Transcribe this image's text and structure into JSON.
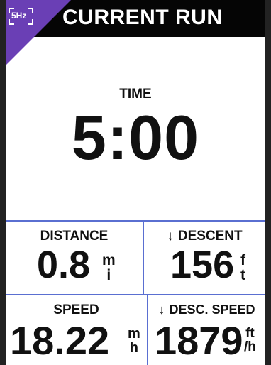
{
  "header": {
    "badge": "5Hz",
    "title": "CURRENT RUN"
  },
  "time": {
    "label": "TIME",
    "value": "5:00"
  },
  "fields": {
    "distance": {
      "label": "DISTANCE",
      "value": "0.8",
      "unit_top": "m",
      "unit_bottom": "i"
    },
    "descent": {
      "arrow": "↓",
      "label": "DESCENT",
      "value": "156",
      "unit_top": "f",
      "unit_bottom": "t"
    },
    "speed": {
      "label": "SPEED",
      "value": "18.22",
      "unit_top": "m",
      "unit_bottom": "h"
    },
    "desc_speed": {
      "arrow": "↓",
      "label": "DESC. SPEED",
      "value": "1879",
      "unit_top": "ft",
      "unit_bottom": "/h"
    }
  },
  "colors": {
    "badge": "#6a3fb5",
    "divider": "#5a6fd1",
    "header_bg": "#050505"
  }
}
